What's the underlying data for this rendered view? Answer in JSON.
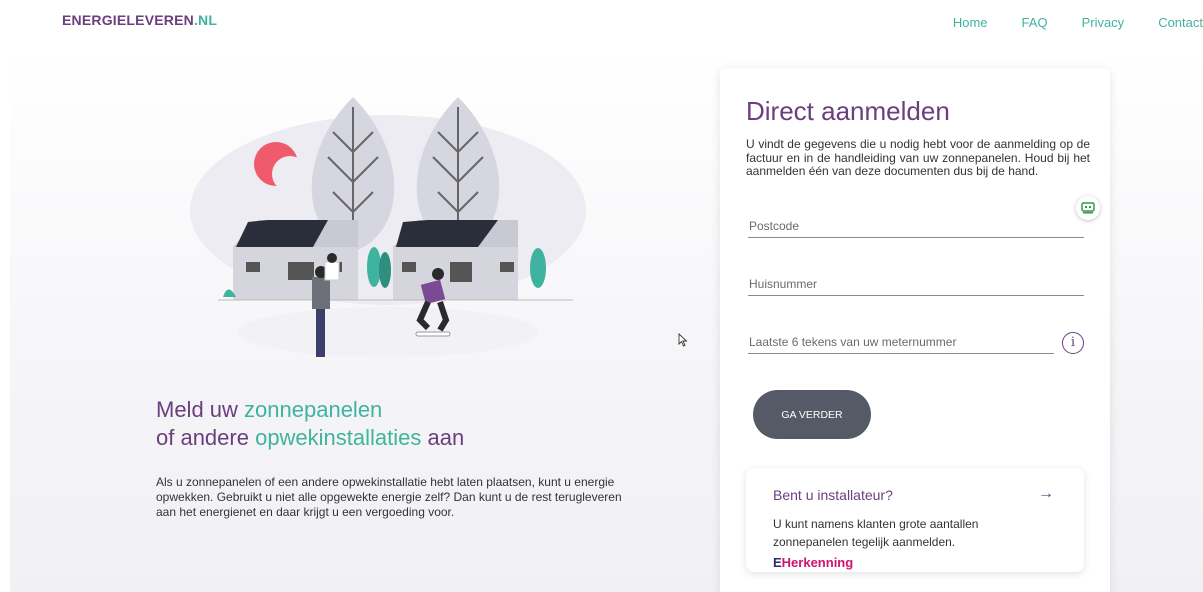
{
  "header": {
    "logo_main": "ENERGIELEVEREN",
    "logo_tld": ".NL",
    "nav": [
      "Home",
      "FAQ",
      "Privacy",
      "Contact"
    ]
  },
  "hero": {
    "headline_line1_prefix": "Meld uw ",
    "headline_line1_accent": "zonnepanelen",
    "headline_line2_prefix": "of andere ",
    "headline_line2_accent": "opwekinstallaties",
    "headline_line2_suffix": " aan",
    "intro": "Als u zonnepanelen of een andere opwekinstallatie hebt laten plaatsen, kunt u energie opwekken. Gebruikt u niet alle opgewekte energie zelf? Dan kunt u de rest terugleveren aan het energienet en daar krijgt u een vergoeding voor."
  },
  "form": {
    "title": "Direct aanmelden",
    "description": "U vindt de gegevens die u nodig hebt voor de aanmelding op de factuur en in de handleiding van uw zonnepanelen. Houd bij het aanmelden één van deze documenten dus bij de hand.",
    "postcode_placeholder": "Postcode",
    "huisnummer_placeholder": "Huisnummer",
    "meter_placeholder": "Laatste 6 tekens van uw meternummer",
    "info_icon_glyph": "i",
    "submit_label": "GA VERDER"
  },
  "installer": {
    "title": "Bent u installateur?",
    "arrow": "→",
    "text": "U kunt namens klanten grote aantallen zonnepanelen tegelijk aanmelden.",
    "eherkenning_mark": "E",
    "eherkenning_text": "Herkenning"
  },
  "icons": {
    "chat": "chat-bot-icon",
    "info": "info-icon",
    "arrow": "arrow-right-icon",
    "cursor": "mouse-cursor-icon"
  },
  "colors": {
    "brand_purple": "#6b3e7e",
    "brand_teal": "#3fb3a0",
    "button_grey": "#555a66",
    "eherkenning_pink": "#d0126b"
  }
}
